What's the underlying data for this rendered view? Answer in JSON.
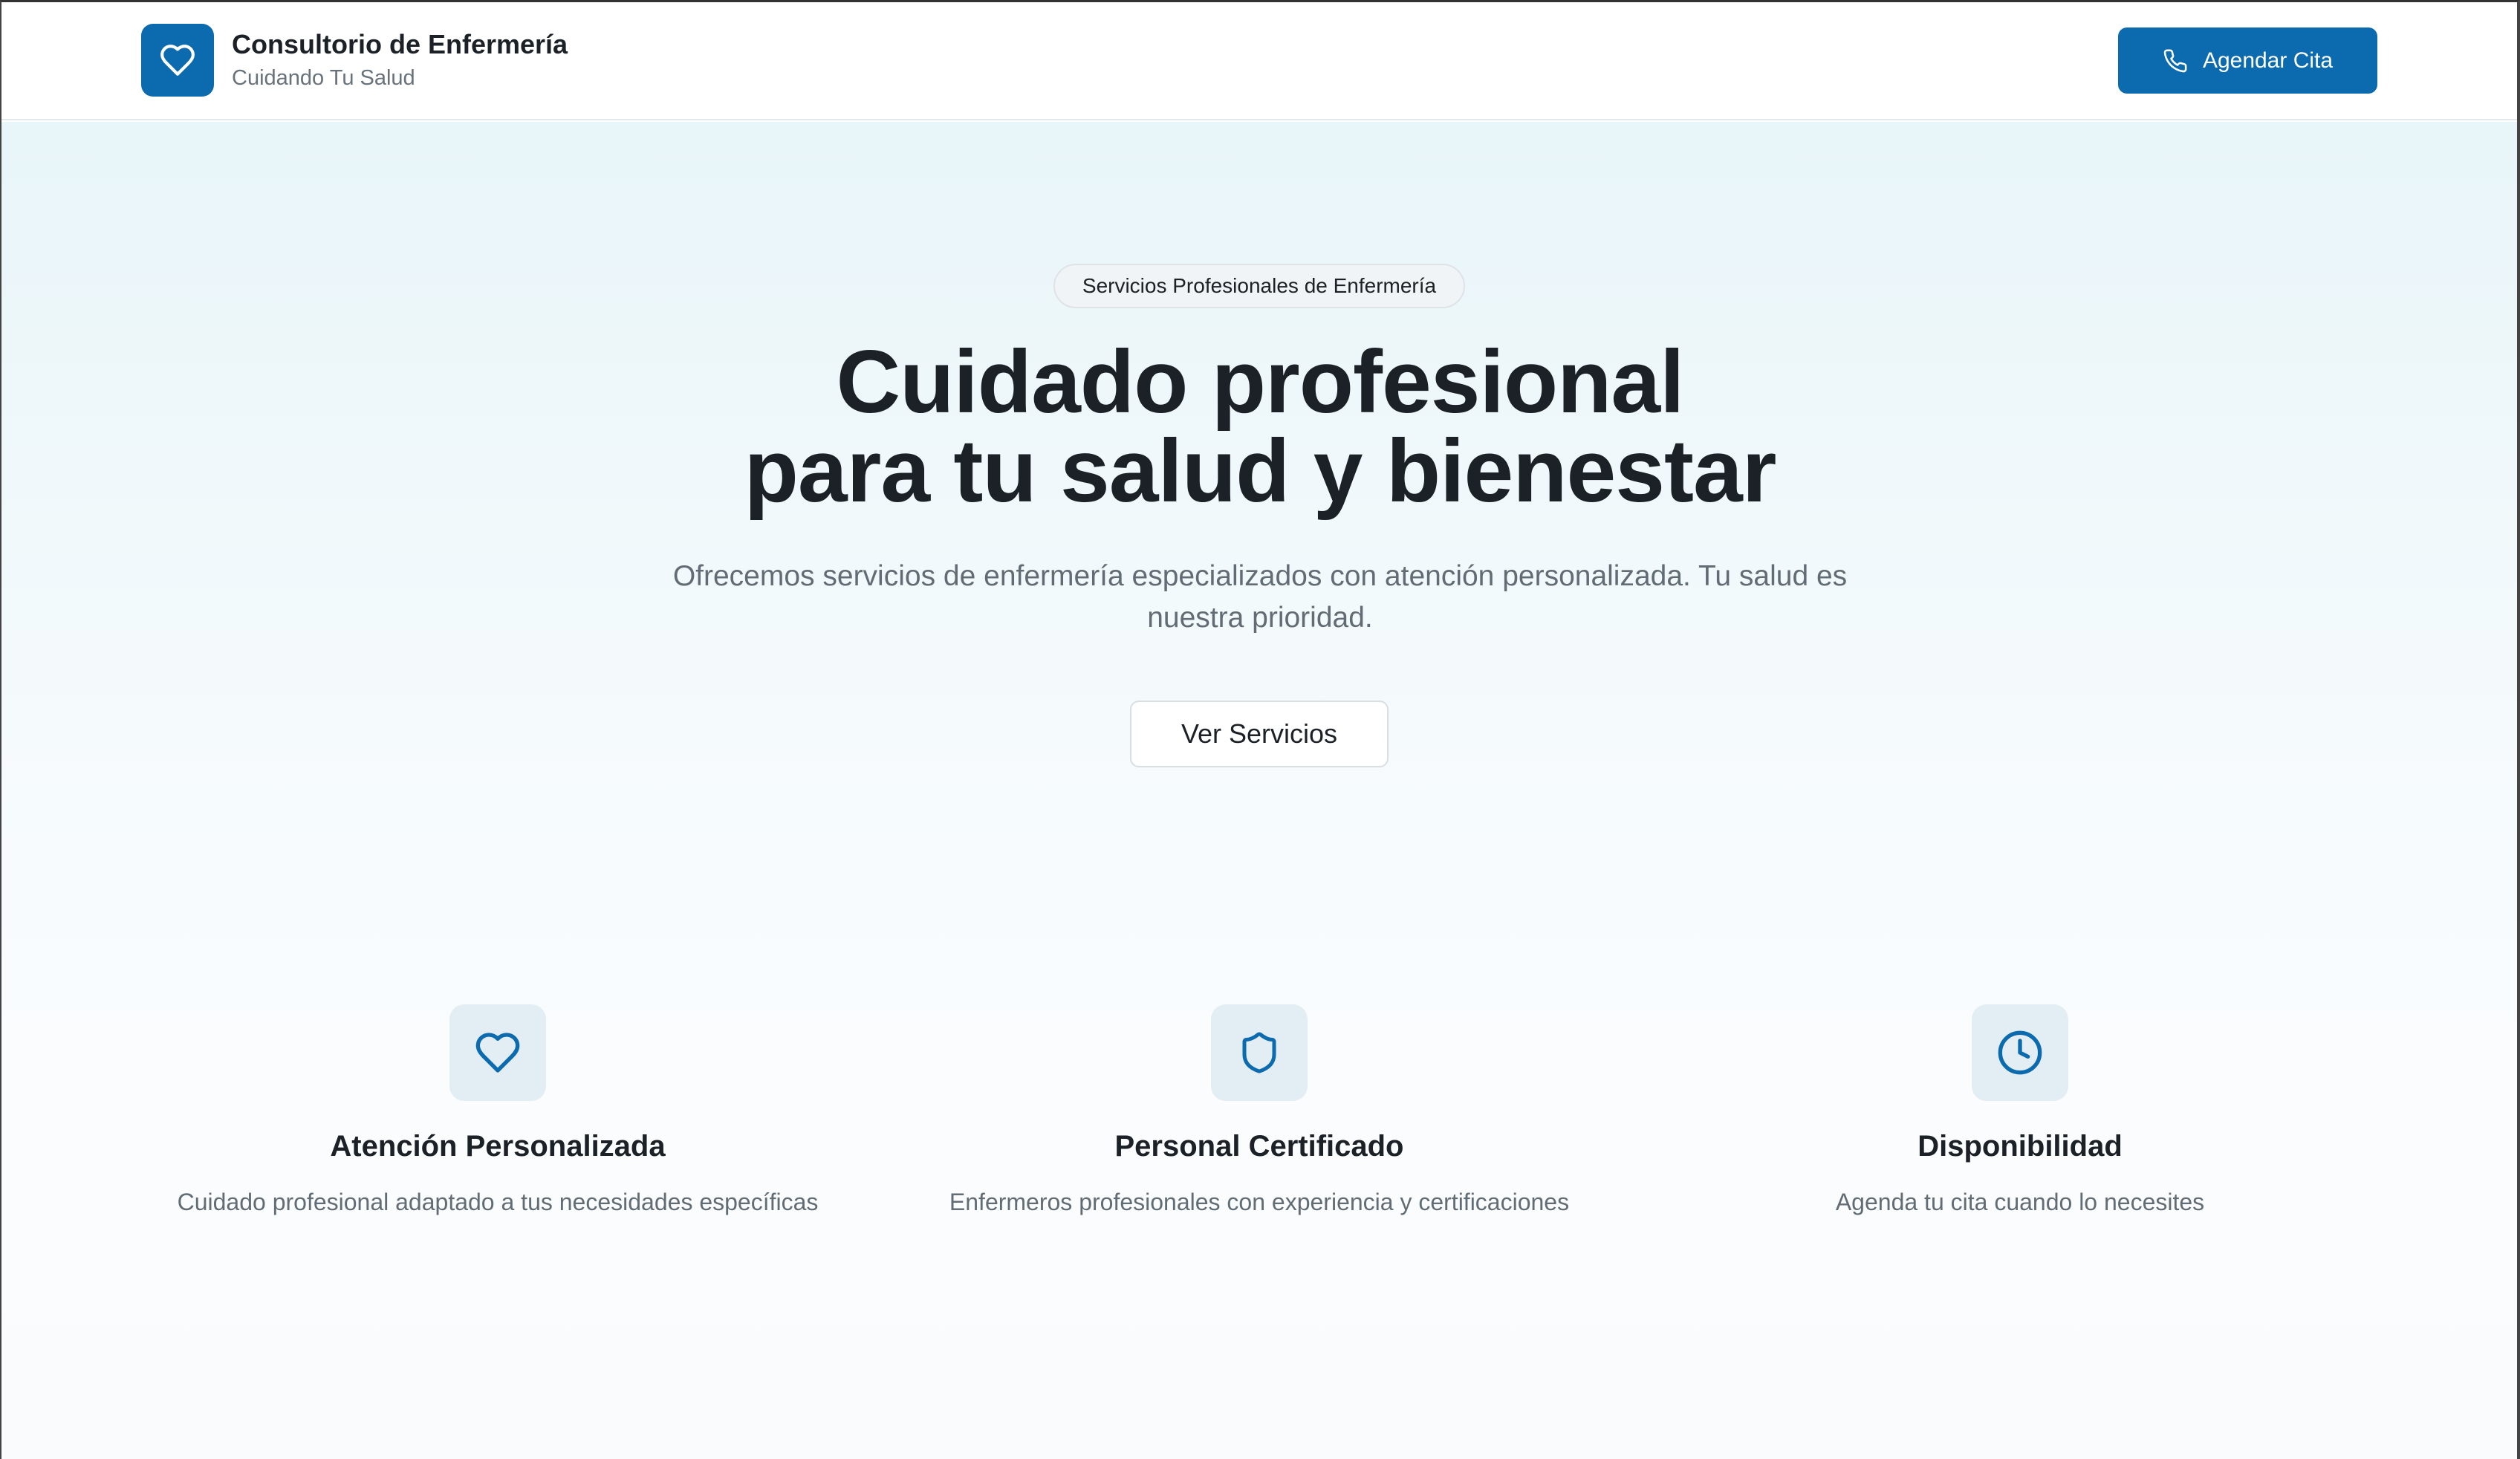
{
  "header": {
    "title": "Consultorio de Enfermería",
    "subtitle": "Cuidando Tu Salud",
    "logo_icon": "heart-icon",
    "cta_label": "Agendar Cita",
    "cta_icon": "phone-icon"
  },
  "hero": {
    "badge": "Servicios Profesionales de Enfermería",
    "headline_line1": "Cuidado profesional",
    "headline_line2": "para tu salud y bienestar",
    "lead": "Ofrecemos servicios de enfermería especializados con atención personalizada. Tu salud es nuestra prioridad.",
    "button_label": "Ver Servicios"
  },
  "features": [
    {
      "icon": "heart-icon",
      "title": "Atención Personalizada",
      "description": "Cuidado profesional adaptado a tus necesidades específicas"
    },
    {
      "icon": "shield-icon",
      "title": "Personal Certificado",
      "description": "Enfermeros profesionales con experiencia y certificaciones"
    },
    {
      "icon": "clock-icon",
      "title": "Disponibilidad",
      "description": "Agenda tu cita cuando lo necesites"
    }
  ],
  "colors": {
    "primary": "#0c6aae",
    "icon_tile": "#e2edf4",
    "text": "#1b2126",
    "muted": "#626c75",
    "hero_top": "#e8f5f9"
  }
}
